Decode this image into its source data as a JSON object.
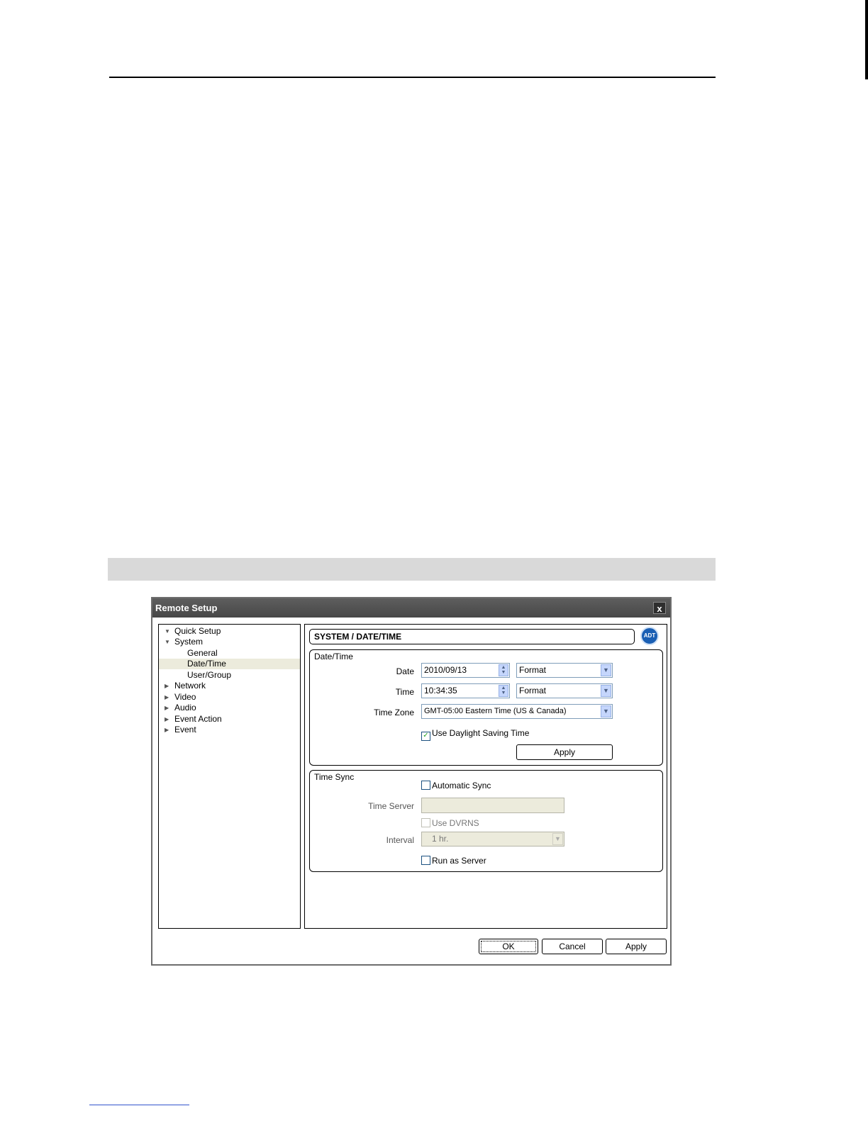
{
  "dialog": {
    "title": "Remote Setup",
    "close": "x"
  },
  "tree": [
    {
      "label": "Quick Setup",
      "arrow": "▼"
    },
    {
      "label": "System",
      "arrow": "▼"
    },
    {
      "label": "General",
      "arrow": ""
    },
    {
      "label": "Date/Time",
      "arrow": ""
    },
    {
      "label": "User/Group",
      "arrow": ""
    },
    {
      "label": "Network",
      "arrow": "▶"
    },
    {
      "label": "Video",
      "arrow": "▶"
    },
    {
      "label": "Audio",
      "arrow": "▶"
    },
    {
      "label": "Event Action",
      "arrow": "▶"
    },
    {
      "label": "Event",
      "arrow": "▶"
    }
  ],
  "header": {
    "title": "SYSTEM / DATE/TIME",
    "logo": "ADT"
  },
  "datetime": {
    "group_title": "Date/Time",
    "date_label": "Date",
    "date_value": "2010/09/13",
    "date_format": "Format",
    "time_label": "Time",
    "time_value": "10:34:35",
    "time_format": "Format",
    "timezone_label": "Time Zone",
    "timezone_value": "GMT-05:00 Eastern Time (US & Canada)",
    "dst_label": "Use Daylight Saving Time",
    "apply": "Apply"
  },
  "timesync": {
    "group_title": "Time Sync",
    "auto_sync": "Automatic Sync",
    "server_label": "Time Server",
    "server_value": "",
    "use_dvrns": "Use DVRNS",
    "interval_label": "Interval",
    "interval_value": "1 hr.",
    "run_as_server": "Run as Server"
  },
  "buttons": {
    "ok": "OK",
    "cancel": "Cancel",
    "apply": "Apply"
  }
}
